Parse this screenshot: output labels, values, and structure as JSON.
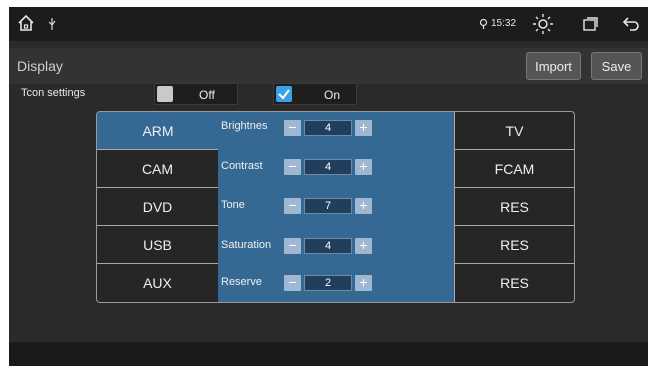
{
  "statusbar": {
    "time": "15:32",
    "icons": [
      "home-icon",
      "usb-icon",
      "location-icon",
      "brightness-icon",
      "window-icon",
      "back-icon"
    ]
  },
  "header": {
    "title": "Display",
    "import_label": "Import",
    "save_label": "Save"
  },
  "tcon": {
    "label": "Tcon settings",
    "off_label": "Off",
    "on_label": "On",
    "selected": "On"
  },
  "sources_left": [
    "ARM",
    "CAM",
    "DVD",
    "USB",
    "AUX"
  ],
  "active_source": "ARM",
  "sources_right": [
    "TV",
    "FCAM",
    "RES",
    "RES",
    "RES"
  ],
  "adjustments": [
    {
      "label": "Brightnes",
      "value": "4"
    },
    {
      "label": "Contrast",
      "value": "4"
    },
    {
      "label": "Tone",
      "value": "7"
    },
    {
      "label": "Saturation",
      "value": "4"
    },
    {
      "label": "Reserve",
      "value": "2"
    }
  ],
  "controls": {
    "minus": "−",
    "plus": "+"
  },
  "colors": {
    "accent": "#356893",
    "checkbox_on": "#3aa0e8"
  }
}
